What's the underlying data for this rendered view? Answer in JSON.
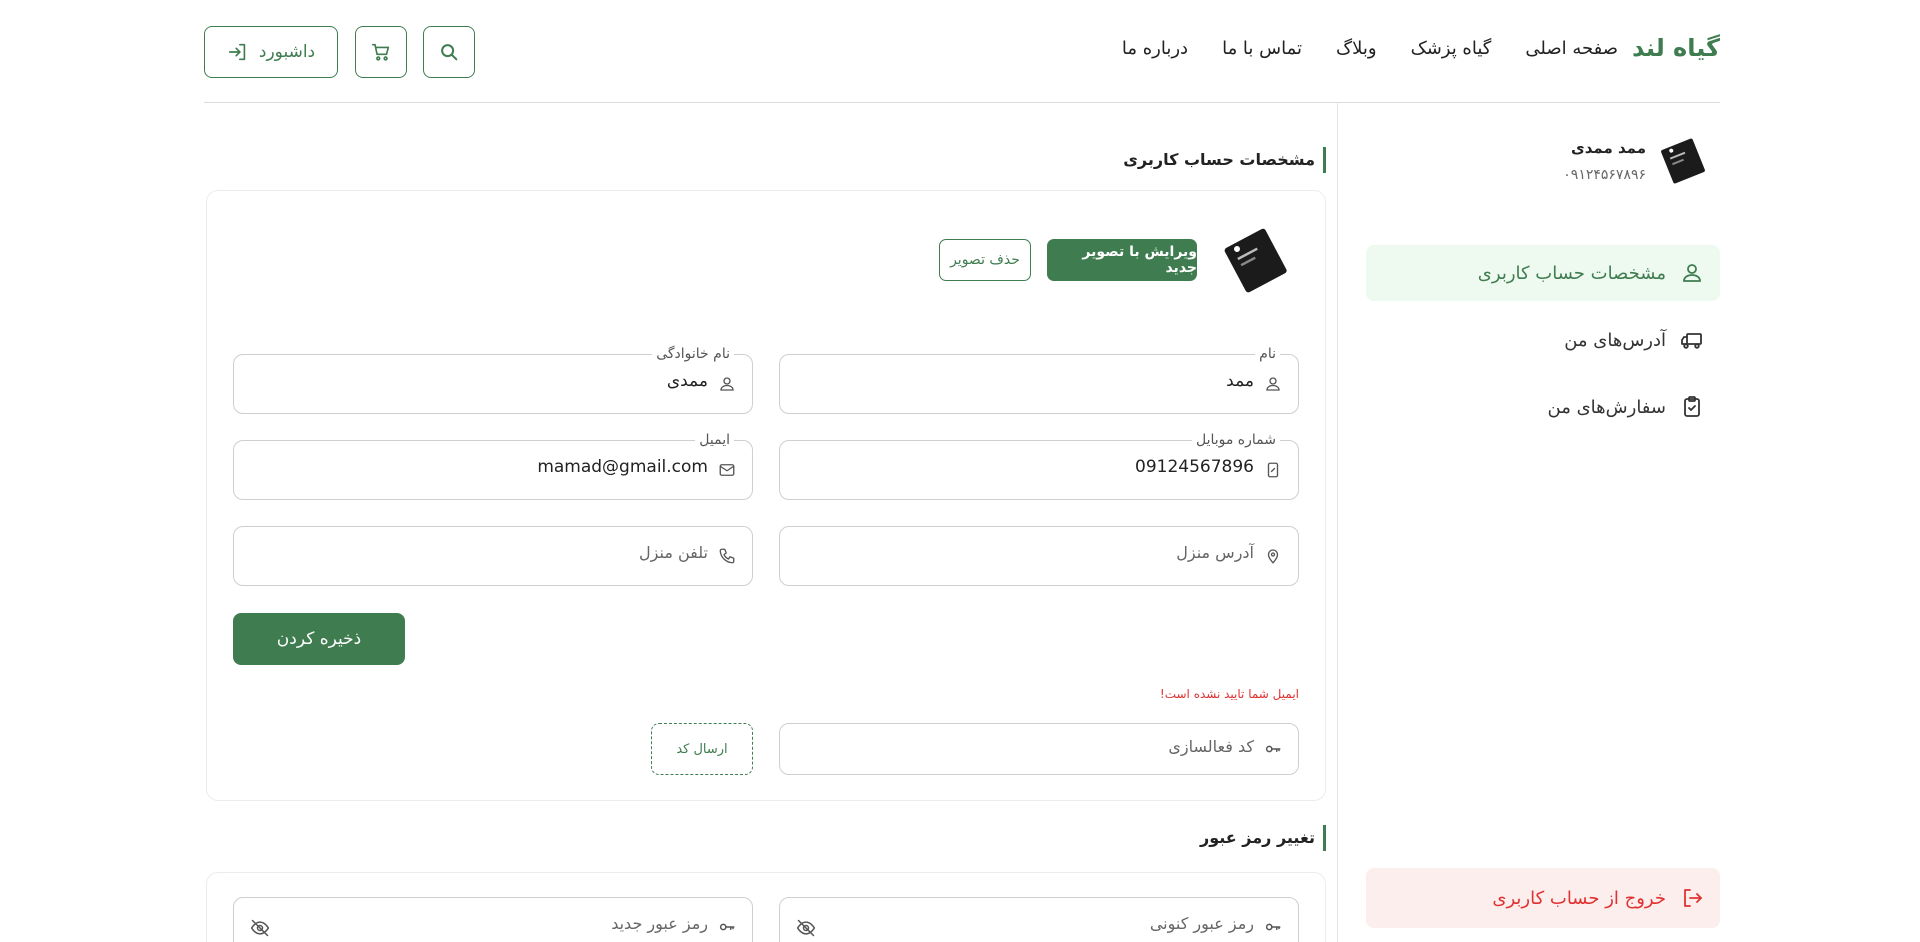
{
  "header": {
    "logo": "گیاه لند",
    "nav": [
      "صفحه اصلی",
      "گیاه پزشک",
      "وبلاگ",
      "تماس با ما",
      "درباره ما"
    ],
    "dashboard_label": "داشبورد"
  },
  "sidebar": {
    "user_name": "ممد ممدی",
    "user_phone": "۰۹۱۲۴۵۶۷۸۹۶",
    "items": [
      {
        "label": "مشخصات حساب کاربری",
        "icon": "user-icon",
        "active": true
      },
      {
        "label": "آدرس‌های من",
        "icon": "truck-icon",
        "active": false
      },
      {
        "label": "سفارش‌های من",
        "icon": "clipboard-check-icon",
        "active": false
      }
    ],
    "logout_label": "خروج از حساب کاربری"
  },
  "account": {
    "section_title": "مشخصات حساب کاربری",
    "edit_image_label": "ویرایش با تصویر جدید",
    "delete_image_label": "حذف تصویر",
    "fields": {
      "first_name": {
        "label": "نام",
        "value": "ممد"
      },
      "last_name": {
        "label": "نام خانوادگی",
        "value": "ممدی"
      },
      "mobile": {
        "label": "شماره موبایل",
        "value": "09124567896"
      },
      "email": {
        "label": "ایمیل",
        "value": "mamad@gmail.com"
      },
      "address": {
        "placeholder": "آدرس منزل"
      },
      "home_phone": {
        "placeholder": "تلفن منزل"
      },
      "activation_code": {
        "placeholder": "کد فعالسازی"
      }
    },
    "save_label": "ذخیره کردن",
    "email_warning": "ایمیل شما تایید نشده است!",
    "send_code_label": "ارسال کد"
  },
  "password": {
    "section_title": "تغییر رمز عبور",
    "current_placeholder": "رمز عبور کنونی",
    "new_placeholder": "رمز عبور جدید"
  },
  "colors": {
    "brand": "#3f7d50",
    "danger": "#e03131",
    "active_bg": "#eefaf0"
  }
}
